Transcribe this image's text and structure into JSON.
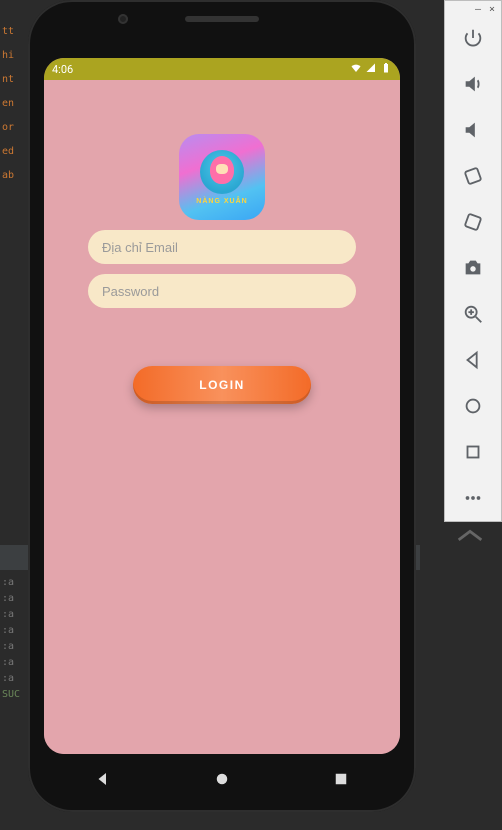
{
  "ide_left_tokens": [
    "",
    "tt",
    "",
    "hi",
    "",
    "",
    "",
    "",
    "",
    "",
    "nt",
    "en",
    "or",
    "",
    "ed",
    "",
    "ab"
  ],
  "ide_bottom_lines": [
    ":a",
    ":a",
    ":a",
    ":a",
    ":a",
    ":a",
    ":a",
    "",
    "SUC"
  ],
  "emu_titlebar": {
    "minimize": "—",
    "close": "×"
  },
  "emu_icons": [
    "power-icon",
    "volume-up-icon",
    "volume-down-icon",
    "rotate-left-icon",
    "rotate-right-icon",
    "camera-icon",
    "zoom-in-icon",
    "back-icon",
    "overview-icon",
    "home-icon",
    "more-icon"
  ],
  "status": {
    "time": "4:06",
    "icons_left": [
      "gear-icon",
      "sdcard-icon"
    ],
    "icons_right": [
      "wifi-icon",
      "signal-icon",
      "battery-icon"
    ]
  },
  "app": {
    "logo_label": "NÀNG XUÂN",
    "email_placeholder": "Địa chỉ Email",
    "password_placeholder": "Password",
    "login_label": "LOGIN"
  },
  "android_nav": [
    "back",
    "home",
    "recents"
  ]
}
